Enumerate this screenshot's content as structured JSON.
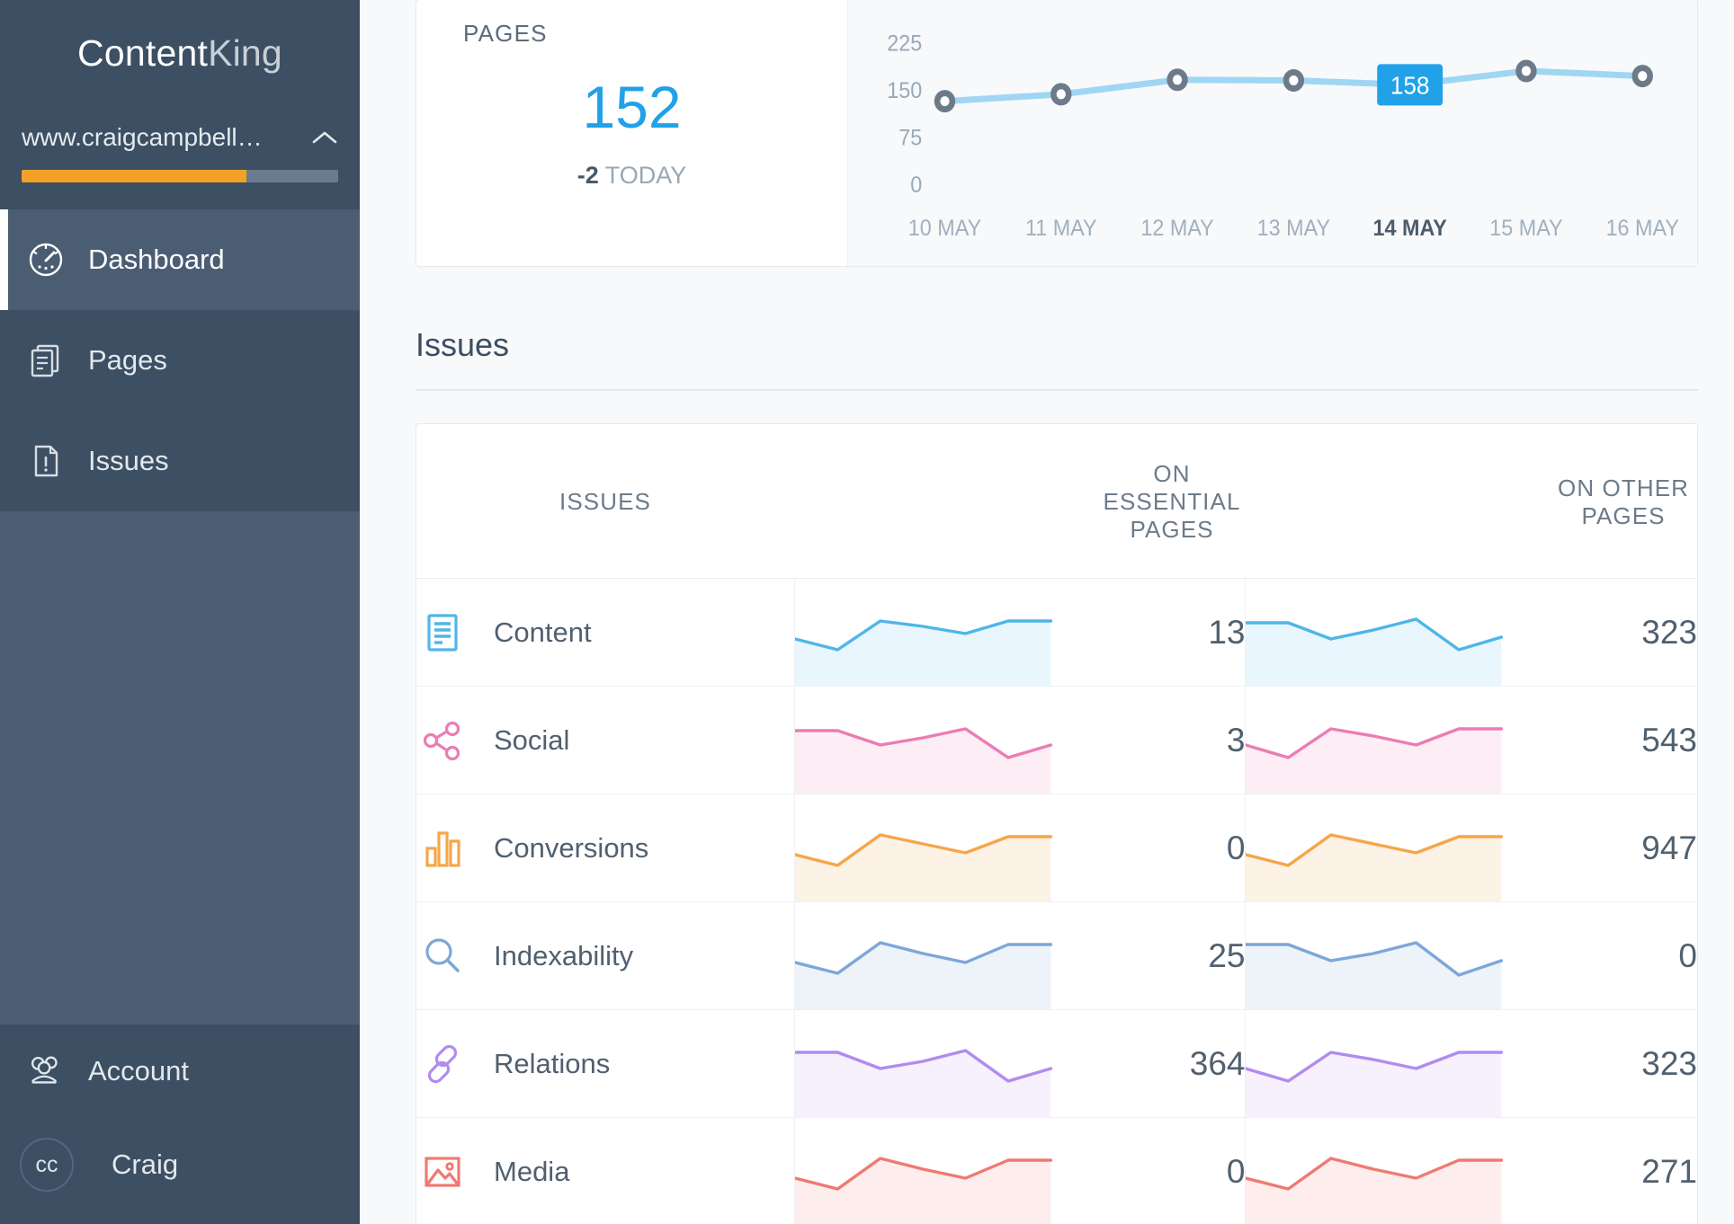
{
  "brand": {
    "part1": "Content",
    "part2": "King"
  },
  "sidebar": {
    "site": {
      "name": "www.craigcampbell…",
      "chevron_icon": "chevron-up-icon",
      "progress_percent": 71
    },
    "items": [
      {
        "label": "Dashboard",
        "icon": "gauge-icon",
        "active": true
      },
      {
        "label": "Pages",
        "icon": "pages-icon",
        "active": false
      },
      {
        "label": "Issues",
        "icon": "issue-document-icon",
        "active": false
      }
    ],
    "footer": [
      {
        "label": "Account",
        "icon": "users-icon"
      },
      {
        "label": "Craig",
        "icon": "avatar",
        "initials": "cc"
      }
    ]
  },
  "metric": {
    "label": "PAGES",
    "value": "152",
    "delta": "-2",
    "delta_suffix": "TODAY",
    "value_color": "#21a1e8"
  },
  "chart_data": {
    "type": "line",
    "title": "PAGES",
    "x": [
      "10 MAY",
      "11 MAY",
      "12 MAY",
      "13 MAY",
      "14 MAY",
      "15 MAY",
      "16 MAY"
    ],
    "values": [
      132,
      143,
      166,
      165,
      158,
      180,
      172
    ],
    "highlight_index": 4,
    "highlight_label": "158",
    "ylabel": "",
    "xlabel": "",
    "yticks": [
      "225",
      "150",
      "75",
      "0"
    ],
    "ylim": [
      0,
      250
    ],
    "grid": false,
    "legend": "none",
    "line_color": "#9fd6f2",
    "marker_color": "#6d7b89",
    "tooltip_bg": "#21a1e8"
  },
  "issues": {
    "heading": "Issues",
    "columns": [
      "ISSUES",
      "ON ESSENTIAL PAGES",
      "ON OTHER PAGES"
    ],
    "rows": [
      {
        "label": "Content",
        "icon": "document-lines-icon",
        "color": "#4eb6e8",
        "fill": "#eaf6fd",
        "essential": {
          "value": "13",
          "spark": [
            52,
            40,
            72,
            66,
            58,
            72,
            72
          ]
        },
        "other": {
          "value": "323",
          "spark": [
            70,
            70,
            52,
            62,
            74,
            40,
            54
          ]
        }
      },
      {
        "label": "Social",
        "icon": "share-nodes-icon",
        "color": "#ec7cb4",
        "fill": "#fdeef6",
        "essential": {
          "value": "3",
          "spark": [
            70,
            70,
            54,
            62,
            72,
            40,
            54
          ]
        },
        "other": {
          "value": "543",
          "spark": [
            54,
            40,
            72,
            64,
            54,
            72,
            72
          ]
        }
      },
      {
        "label": "Conversions",
        "icon": "bar-chart-icon",
        "color": "#f5a64a",
        "fill": "#fdf2e6",
        "essential": {
          "value": "0",
          "spark": [
            52,
            40,
            74,
            64,
            54,
            72,
            72
          ]
        },
        "other": {
          "value": "947",
          "spark": [
            52,
            40,
            74,
            64,
            54,
            72,
            72
          ]
        }
      },
      {
        "label": "Indexability",
        "icon": "magnifier-icon",
        "color": "#7da7d9",
        "fill": "#eef3f9",
        "essential": {
          "value": "25",
          "spark": [
            52,
            40,
            74,
            62,
            52,
            72,
            72
          ]
        },
        "other": {
          "value": "0",
          "spark": [
            72,
            72,
            54,
            62,
            74,
            38,
            54
          ]
        }
      },
      {
        "label": "Relations",
        "icon": "link-chain-icon",
        "color": "#b18bf0",
        "fill": "#f6f1fd",
        "essential": {
          "value": "364",
          "spark": [
            72,
            72,
            54,
            62,
            74,
            40,
            54
          ]
        },
        "other": {
          "value": "323",
          "spark": [
            54,
            40,
            72,
            64,
            54,
            72,
            72
          ]
        }
      },
      {
        "label": "Media",
        "icon": "image-icon",
        "color": "#ef7a72",
        "fill": "#fdeeed",
        "essential": {
          "value": "0",
          "spark": [
            52,
            40,
            74,
            62,
            52,
            72,
            72
          ]
        },
        "other": {
          "value": "271",
          "spark": [
            52,
            40,
            74,
            62,
            52,
            72,
            72
          ]
        }
      }
    ]
  }
}
